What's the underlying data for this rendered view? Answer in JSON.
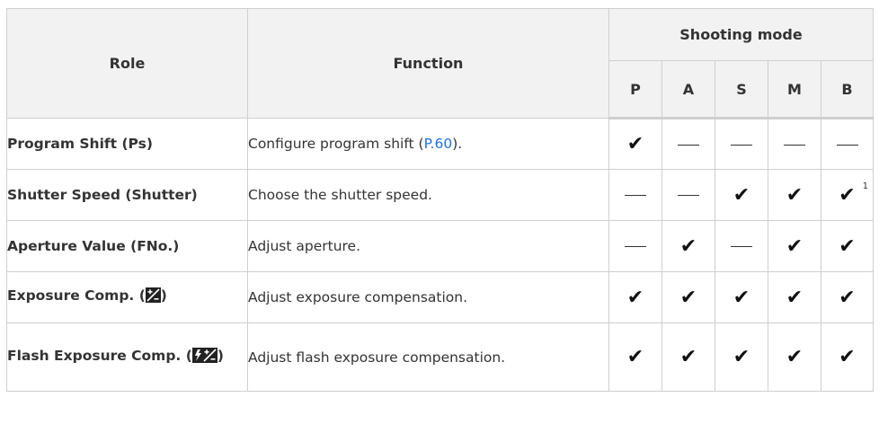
{
  "header": {
    "role": "Role",
    "function": "Function",
    "shooting_mode": "Shooting mode",
    "modes": [
      "P",
      "A",
      "S",
      "M",
      "B"
    ]
  },
  "rows": [
    {
      "role": "Program Shift (Ps)",
      "function_pre": "Configure program shift (",
      "function_link": "P.60",
      "function_post": ").",
      "marks": [
        "check",
        "dash",
        "dash",
        "dash",
        "dash"
      ]
    },
    {
      "role": "Shutter Speed (Shutter)",
      "function": "Choose the shutter speed.",
      "marks": [
        "dash",
        "dash",
        "check",
        "check",
        "check"
      ],
      "b_footnote": "1"
    },
    {
      "role": "Aperture Value (FNo.)",
      "function": "Adjust aperture.",
      "marks": [
        "dash",
        "check",
        "dash",
        "check",
        "check"
      ]
    },
    {
      "role_pre": "Exposure Comp. (",
      "role_post": ")",
      "role_icon": "exposure-comp-icon",
      "function": "Adjust exposure compensation.",
      "marks": [
        "check",
        "check",
        "check",
        "check",
        "check"
      ]
    },
    {
      "role_pre": "Flash Exposure Comp. (",
      "role_post": ")",
      "role_icon": "flash-exposure-comp-icon",
      "function": "Adjust flash exposure compensation.",
      "marks": [
        "check",
        "check",
        "check",
        "check",
        "check"
      ]
    }
  ],
  "colors": {
    "link": "#1a73e8",
    "header_bg": "#f2f2f2",
    "border": "#cfcfcf"
  }
}
